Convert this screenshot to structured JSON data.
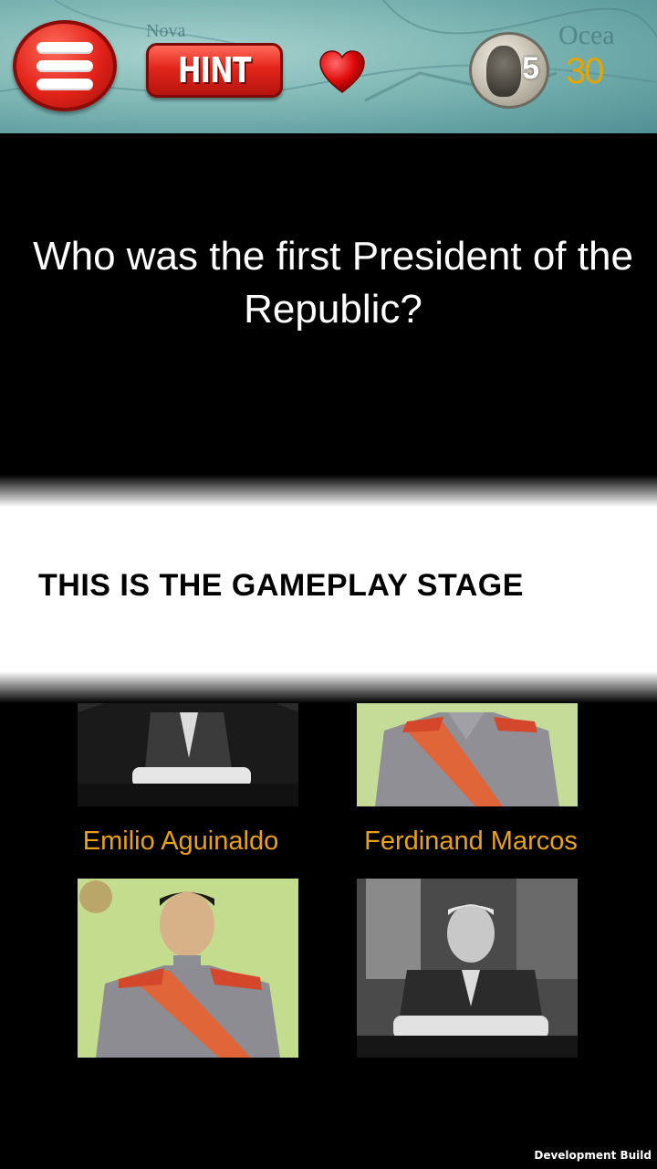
{
  "header": {
    "hint_label": "HINT",
    "coin_denomination": "5",
    "coin_count": "30",
    "map_words": [
      "Nova",
      "Ocea"
    ]
  },
  "question": {
    "text": "Who was the first President of the Republic?"
  },
  "banner": {
    "text": "THIS IS THE GAMEPLAY STAGE"
  },
  "answers": [
    {
      "label": "Emilio Aguinaldo"
    },
    {
      "label": "Ferdinand Marcos"
    }
  ],
  "footer": {
    "build_label": "Development Build"
  },
  "colors": {
    "accent": "#e8a21a",
    "button_red": "#e3261c",
    "coin_text": "#e6a600"
  }
}
